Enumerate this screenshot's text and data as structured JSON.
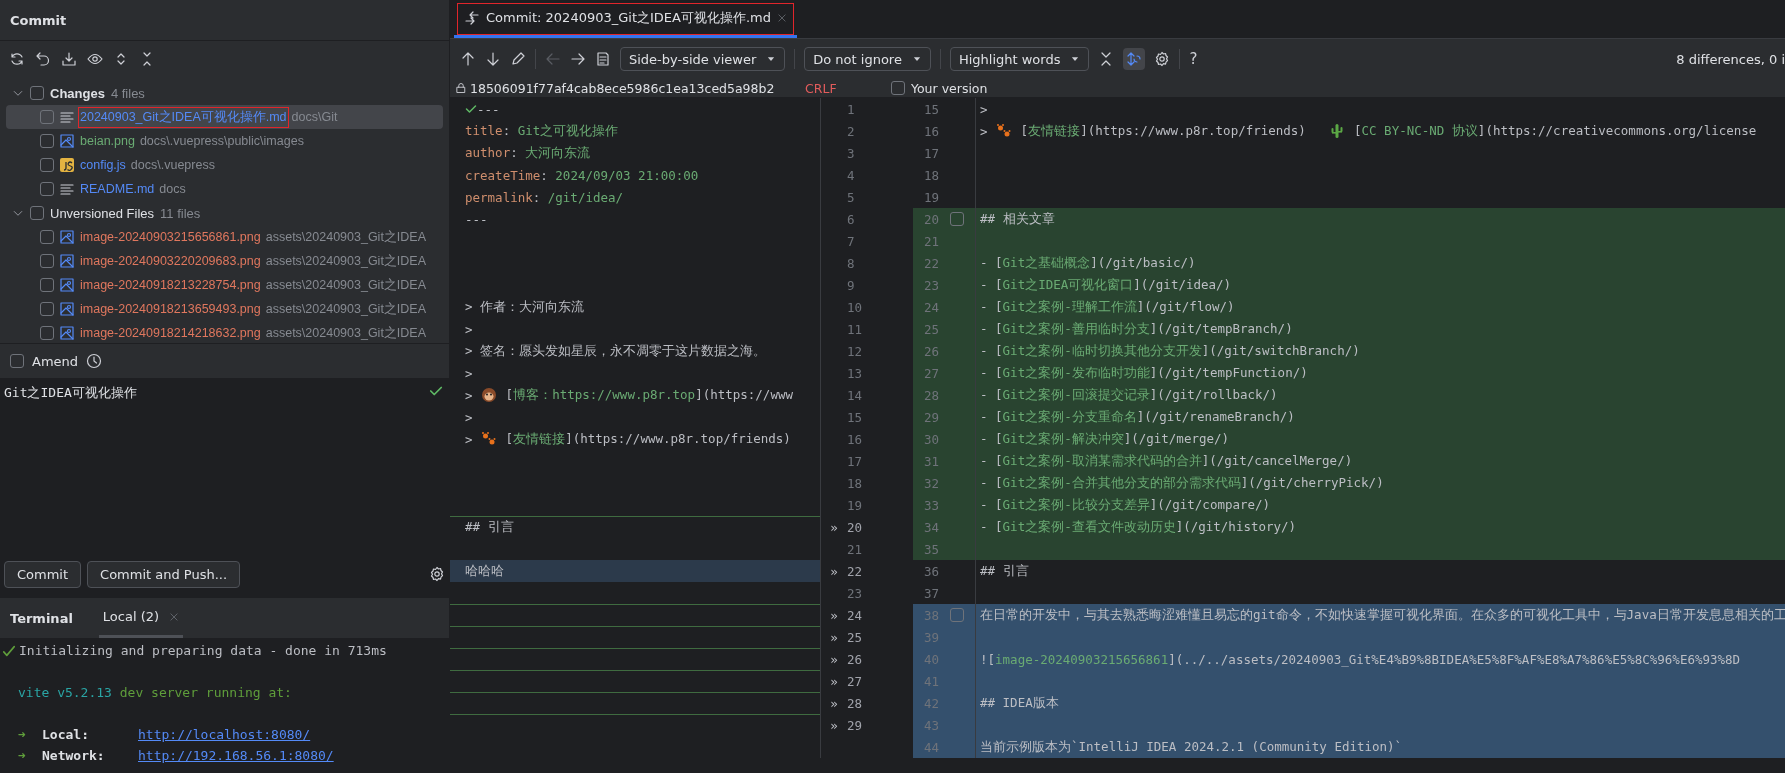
{
  "commit_panel": {
    "title": "Commit",
    "groups": [
      {
        "label": "Changes",
        "count": "4 files",
        "expanded": true,
        "checked": false,
        "items": [
          {
            "name": "20240903_Git之IDEA可视化操作.md",
            "path": "docs\\Git",
            "kind": "md",
            "color": "#548af7",
            "selected": true,
            "checked": false,
            "annotated": true
          },
          {
            "name": "beian.png",
            "path": "docs\\.vuepress\\public\\images",
            "kind": "image",
            "color": "#6aab73",
            "selected": false,
            "checked": false
          },
          {
            "name": "config.js",
            "path": "docs\\.vuepress",
            "kind": "js",
            "color": "#548af7",
            "selected": false,
            "checked": false
          },
          {
            "name": "README.md",
            "path": "docs",
            "kind": "md",
            "color": "#548af7",
            "selected": false,
            "checked": false
          }
        ]
      },
      {
        "label": "Unversioned Files",
        "count": "11 files",
        "expanded": true,
        "checked": false,
        "items": [
          {
            "name": "image-20240903215656861.png",
            "path": "assets\\20240903_Git之IDEA",
            "kind": "image",
            "color": "#e0775e",
            "selected": false,
            "checked": false
          },
          {
            "name": "image-20240903220209683.png",
            "path": "assets\\20240903_Git之IDEA",
            "kind": "image",
            "color": "#e0775e",
            "selected": false,
            "checked": false
          },
          {
            "name": "image-20240918213228754.png",
            "path": "assets\\20240903_Git之IDEA",
            "kind": "image",
            "color": "#e0775e",
            "selected": false,
            "checked": false
          },
          {
            "name": "image-20240918213659493.png",
            "path": "assets\\20240903_Git之IDEA",
            "kind": "image",
            "color": "#e0775e",
            "selected": false,
            "checked": false
          },
          {
            "name": "image-20240918214218632.png",
            "path": "assets\\20240903_Git之IDEA",
            "kind": "image",
            "color": "#e0775e",
            "selected": false,
            "checked": false
          }
        ]
      }
    ],
    "amend": {
      "label": "Amend",
      "checked": false
    },
    "message": "Git之IDEA可视化操作",
    "buttons": [
      "Commit",
      "Commit and Push..."
    ]
  },
  "terminal": {
    "title": "Terminal",
    "tabs": [
      {
        "label": "Local (2)",
        "selected": true
      }
    ],
    "lines": [
      {
        "kind": "done",
        "tokens": [
          {
            "text": "Initializing and preparing data - done in 713ms",
            "kind": "text"
          }
        ]
      },
      {
        "kind": "blank"
      },
      {
        "kind": "plain",
        "tokens": [
          {
            "text": "vite v5.2.13",
            "kind": "teal"
          },
          {
            "text": " dev server running at:",
            "kind": "green"
          }
        ]
      },
      {
        "kind": "blank"
      },
      {
        "kind": "link",
        "arrow": "➜",
        "label": "Local:",
        "url": "http://localhost:8080/"
      },
      {
        "kind": "link",
        "arrow": "➜",
        "label": "Network:",
        "url": "http://192.168.56.1:8080/"
      }
    ]
  },
  "editor_tab": {
    "title": "Commit: 20240903_Git之IDEA可视化操作.md",
    "selected": true,
    "annotated": true
  },
  "diff_toolbar": {
    "dropdowns": [
      "Side-by-side viewer",
      "Do not ignore",
      "Highlight words"
    ],
    "sync_scroll": true,
    "help": "?",
    "summary": "8 differences, 0 i"
  },
  "diff_header": {
    "revision": "18506091f77af4cab8ece5986c1ea13ced5a98b2",
    "line_separator": "CRLF",
    "your_version": {
      "label": "Your version",
      "checked": false
    }
  },
  "rows": [
    {
      "left": {
        "n": "1",
        "kind": "plain",
        "tokens": [
          {
            "text": "---",
            "kind": "text"
          }
        ]
      },
      "right": {
        "n": "15",
        "kind": "plain",
        "tokens": [
          {
            "text": ">",
            "kind": "text"
          }
        ]
      }
    },
    {
      "left": {
        "n": "2",
        "kind": "plain",
        "tokens": [
          {
            "text": "title",
            "kind": "key"
          },
          {
            "text": ": ",
            "kind": "text"
          },
          {
            "text": "Git之可视化操作",
            "kind": "value"
          }
        ]
      },
      "right": {
        "n": "16",
        "kind": "plain",
        "tokens": [
          {
            "text": "> ",
            "kind": "text"
          },
          {
            "kind": "paws"
          },
          {
            "text": " [",
            "kind": "text"
          },
          {
            "text": "友情链接",
            "kind": "value"
          },
          {
            "text": "](https://www.p8r.top/friends)   ",
            "kind": "text"
          },
          {
            "kind": "cactus"
          },
          {
            "text": " [",
            "kind": "text"
          },
          {
            "text": "CC BY-NC-ND 协议",
            "kind": "value"
          },
          {
            "text": "](https://creativecommons.org/license",
            "kind": "text"
          }
        ]
      }
    },
    {
      "left": {
        "n": "3",
        "kind": "plain",
        "tokens": [
          {
            "text": "author",
            "kind": "key"
          },
          {
            "text": ": ",
            "kind": "text"
          },
          {
            "text": "大河向东流",
            "kind": "value"
          }
        ]
      },
      "right": {
        "n": "17",
        "kind": "plain"
      }
    },
    {
      "left": {
        "n": "4",
        "kind": "plain",
        "tokens": [
          {
            "text": "createTime",
            "kind": "key"
          },
          {
            "text": ": ",
            "kind": "text"
          },
          {
            "text": "2024/09/03 21:00:00",
            "kind": "value"
          }
        ]
      },
      "right": {
        "n": "18",
        "kind": "plain"
      }
    },
    {
      "left": {
        "n": "5",
        "kind": "plain",
        "tokens": [
          {
            "text": "permalink",
            "kind": "key"
          },
          {
            "text": ": ",
            "kind": "text"
          },
          {
            "text": "/git/idea/",
            "kind": "value"
          }
        ]
      },
      "right": {
        "n": "19",
        "kind": "plain"
      }
    },
    {
      "left": {
        "n": "6",
        "kind": "plain",
        "tokens": [
          {
            "text": "---",
            "kind": "text"
          }
        ]
      },
      "right": {
        "n": "20",
        "kind": "inserted",
        "tokens": [
          {
            "text": "## 相关文章",
            "kind": "text"
          }
        ]
      },
      "checkbox": {
        "checked": false
      }
    },
    {
      "left": {
        "n": "7",
        "kind": "plain"
      },
      "right": {
        "n": "21",
        "kind": "inserted"
      }
    },
    {
      "left": {
        "n": "8",
        "kind": "plain"
      },
      "right": {
        "n": "22",
        "kind": "inserted",
        "tokens": [
          {
            "text": "- [",
            "kind": "text"
          },
          {
            "text": "Git之基础概念",
            "kind": "value"
          },
          {
            "text": "](/git/basic/)",
            "kind": "text"
          }
        ]
      }
    },
    {
      "left": {
        "n": "9",
        "kind": "plain"
      },
      "right": {
        "n": "23",
        "kind": "inserted",
        "tokens": [
          {
            "text": "- [",
            "kind": "text"
          },
          {
            "text": "Git之IDEA可视化窗口",
            "kind": "value"
          },
          {
            "text": "](/git/idea/)",
            "kind": "text"
          }
        ]
      }
    },
    {
      "left": {
        "n": "10",
        "kind": "plain",
        "tokens": [
          {
            "text": "> 作者：大河向东流",
            "kind": "text"
          }
        ]
      },
      "right": {
        "n": "24",
        "kind": "inserted",
        "tokens": [
          {
            "text": "- [",
            "kind": "text"
          },
          {
            "text": "Git之案例-理解工作流",
            "kind": "value"
          },
          {
            "text": "](/git/flow/)",
            "kind": "text"
          }
        ]
      }
    },
    {
      "left": {
        "n": "11",
        "kind": "plain",
        "tokens": [
          {
            "text": ">",
            "kind": "text"
          }
        ]
      },
      "right": {
        "n": "25",
        "kind": "inserted",
        "tokens": [
          {
            "text": "- [",
            "kind": "text"
          },
          {
            "text": "Git之案例-善用临时分支",
            "kind": "value"
          },
          {
            "text": "](/git/tempBranch/)",
            "kind": "text"
          }
        ]
      }
    },
    {
      "left": {
        "n": "12",
        "kind": "plain",
        "tokens": [
          {
            "text": "> 签名：愿头发如星辰，永不凋零于这片数据之海。",
            "kind": "text"
          }
        ]
      },
      "right": {
        "n": "26",
        "kind": "inserted",
        "tokens": [
          {
            "text": "- [",
            "kind": "text"
          },
          {
            "text": "Git之案例-临时切换其他分支开发",
            "kind": "value"
          },
          {
            "text": "](/git/switchBranch/)",
            "kind": "text"
          }
        ]
      }
    },
    {
      "left": {
        "n": "13",
        "kind": "plain",
        "tokens": [
          {
            "text": ">",
            "kind": "text"
          }
        ]
      },
      "right": {
        "n": "27",
        "kind": "inserted",
        "tokens": [
          {
            "text": "- [",
            "kind": "text"
          },
          {
            "text": "Git之案例-发布临时功能",
            "kind": "value"
          },
          {
            "text": "](/git/tempFunction/)",
            "kind": "text"
          }
        ]
      }
    },
    {
      "left": {
        "n": "14",
        "kind": "plain",
        "tokens": [
          {
            "text": "> ",
            "kind": "text"
          },
          {
            "kind": "monkey"
          },
          {
            "text": " [",
            "kind": "text"
          },
          {
            "text": "博客：https://www.p8r.top",
            "kind": "value"
          },
          {
            "text": "](https://www",
            "kind": "text"
          }
        ]
      },
      "right": {
        "n": "28",
        "kind": "inserted",
        "tokens": [
          {
            "text": "- [",
            "kind": "text"
          },
          {
            "text": "Git之案例-回滚提交记录",
            "kind": "value"
          },
          {
            "text": "](/git/rollback/)",
            "kind": "text"
          }
        ]
      }
    },
    {
      "left": {
        "n": "15",
        "kind": "plain",
        "tokens": [
          {
            "text": ">",
            "kind": "text"
          }
        ]
      },
      "right": {
        "n": "29",
        "kind": "inserted",
        "tokens": [
          {
            "text": "- [",
            "kind": "text"
          },
          {
            "text": "Git之案例-分支重命名",
            "kind": "value"
          },
          {
            "text": "](/git/renameBranch/)",
            "kind": "text"
          }
        ]
      }
    },
    {
      "left": {
        "n": "16",
        "kind": "plain",
        "tokens": [
          {
            "text": "> ",
            "kind": "text"
          },
          {
            "kind": "paws"
          },
          {
            "text": " [",
            "kind": "text"
          },
          {
            "text": "友情链接",
            "kind": "value"
          },
          {
            "text": "](https://www.p8r.top/friends)",
            "kind": "text"
          }
        ]
      },
      "right": {
        "n": "30",
        "kind": "inserted",
        "tokens": [
          {
            "text": "- [",
            "kind": "text"
          },
          {
            "text": "Git之案例-解决冲突",
            "kind": "value"
          },
          {
            "text": "](/git/merge/)",
            "kind": "text"
          }
        ]
      }
    },
    {
      "left": {
        "n": "17",
        "kind": "plain"
      },
      "right": {
        "n": "31",
        "kind": "inserted",
        "tokens": [
          {
            "text": "- [",
            "kind": "text"
          },
          {
            "text": "Git之案例-取消某需求代码的合并",
            "kind": "value"
          },
          {
            "text": "](/git/cancelMerge/)",
            "kind": "text"
          }
        ]
      }
    },
    {
      "left": {
        "n": "18",
        "kind": "plain"
      },
      "right": {
        "n": "32",
        "kind": "inserted",
        "tokens": [
          {
            "text": "- [",
            "kind": "text"
          },
          {
            "text": "Git之案例-合并其他分支的部分需求代码",
            "kind": "value"
          },
          {
            "text": "](/git/cherryPick/)",
            "kind": "text"
          }
        ]
      }
    },
    {
      "left": {
        "n": "19",
        "kind": "plain"
      },
      "right": {
        "n": "33",
        "kind": "inserted",
        "tokens": [
          {
            "text": "- [",
            "kind": "text"
          },
          {
            "text": "Git之案例-比较分支差异",
            "kind": "value"
          },
          {
            "text": "](/git/compare/)",
            "kind": "text"
          }
        ]
      }
    },
    {
      "left": {
        "n": "20",
        "kind": "ruled",
        "tokens": [
          {
            "text": "## 引言",
            "kind": "text"
          }
        ]
      },
      "right": {
        "n": "34",
        "kind": "inserted",
        "tokens": [
          {
            "text": "- [",
            "kind": "text"
          },
          {
            "text": "Git之案例-查看文件改动历史",
            "kind": "value"
          },
          {
            "text": "](/git/history/)",
            "kind": "text"
          }
        ]
      },
      "apply": "»"
    },
    {
      "left": {
        "n": "21",
        "kind": "plain"
      },
      "right": {
        "n": "35",
        "kind": "inserted"
      }
    },
    {
      "left": {
        "n": "22",
        "kind": "modified",
        "tokens": [
          {
            "text": "哈哈哈",
            "kind": "text"
          }
        ]
      },
      "right": {
        "n": "36",
        "kind": "plain",
        "tokens": [
          {
            "text": "## 引言",
            "kind": "text"
          }
        ]
      },
      "apply": "»"
    },
    {
      "left": {
        "n": "23",
        "kind": "plain"
      },
      "right": {
        "n": "37",
        "kind": "plain"
      }
    },
    {
      "left": {
        "n": "24",
        "kind": "ruled"
      },
      "right": {
        "n": "38",
        "kind": "modified",
        "tokens": [
          {
            "text": "在日常的开发中，与其去熟悉晦涩难懂且易忘的git命令，不如快速掌握可视化界面。在众多的可视化工具中，与Java日常开发息息相关的工",
            "kind": "text"
          }
        ]
      },
      "apply": "»",
      "checkbox": {
        "checked": false
      }
    },
    {
      "left": {
        "n": "25",
        "kind": "ruled"
      },
      "right": {
        "n": "39",
        "kind": "modified"
      },
      "apply": "»"
    },
    {
      "left": {
        "n": "26",
        "kind": "ruled"
      },
      "right": {
        "n": "40",
        "kind": "modified",
        "tokens": [
          {
            "text": "![",
            "kind": "text"
          },
          {
            "text": "image-20240903215656861",
            "kind": "value"
          },
          {
            "text": "](../../assets/20240903_Git%E4%B9%8BIDEA%E5%8F%AF%E8%A7%86%E5%8C%96%E6%93%8D",
            "kind": "text"
          }
        ]
      },
      "apply": "»"
    },
    {
      "left": {
        "n": "27",
        "kind": "ruled"
      },
      "right": {
        "n": "41",
        "kind": "modified"
      },
      "apply": "»"
    },
    {
      "left": {
        "n": "28",
        "kind": "ruled"
      },
      "right": {
        "n": "42",
        "kind": "modified",
        "tokens": [
          {
            "text": "## IDEA版本",
            "kind": "text"
          }
        ]
      },
      "apply": "»"
    },
    {
      "left": {
        "n": "29",
        "kind": "ruled"
      },
      "right": {
        "n": "43",
        "kind": "modified"
      },
      "apply": "»"
    },
    {
      "right": {
        "n": "44",
        "kind": "modified",
        "tokens": [
          {
            "text": "当前示例版本为`IntelliJ IDEA 2024.2.1 (Community Edition)`",
            "kind": "text"
          }
        ]
      }
    }
  ]
}
